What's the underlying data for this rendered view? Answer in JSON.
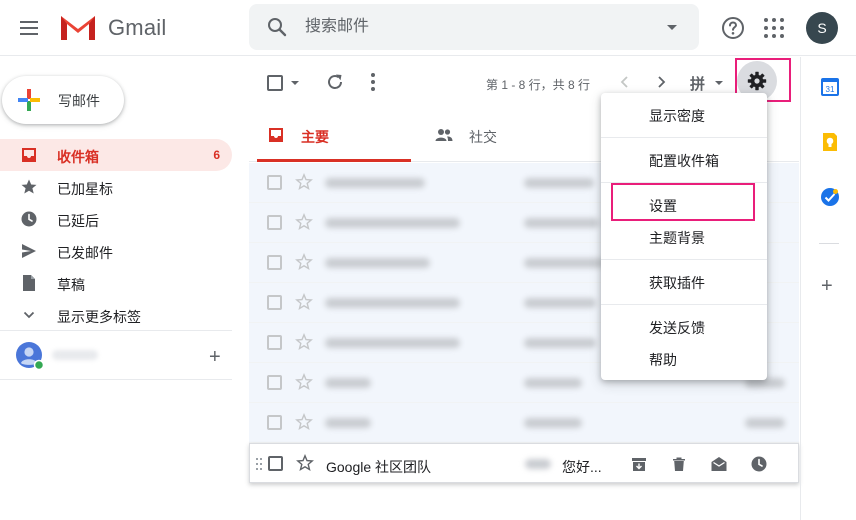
{
  "header": {
    "brand": "Gmail",
    "search_placeholder": "搜索邮件",
    "account_initial": "S",
    "icons": [
      "menu-icon",
      "gmail-logo",
      "search-icon",
      "search-options-icon",
      "help-icon",
      "apps-icon"
    ]
  },
  "compose": {
    "label": "写邮件"
  },
  "nav": {
    "items": [
      {
        "label": "收件箱",
        "count": "6",
        "icon": "inbox-icon",
        "active": true
      },
      {
        "label": "已加星标",
        "count": "",
        "icon": "star-icon",
        "active": false
      },
      {
        "label": "已延后",
        "count": "",
        "icon": "clock-icon",
        "active": false
      },
      {
        "label": "已发邮件",
        "count": "",
        "icon": "send-icon",
        "active": false
      },
      {
        "label": "草稿",
        "count": "",
        "icon": "draft-icon",
        "active": false
      },
      {
        "label": "显示更多标签",
        "count": "",
        "icon": "chevron-down-icon",
        "active": false
      }
    ]
  },
  "toolbar": {
    "page_info": "第 1 - 8 行，共 8 行",
    "ime_label": "拼"
  },
  "tabs": [
    {
      "label": "主要",
      "icon": "inbox-icon"
    },
    {
      "label": "社交",
      "icon": "people-icon"
    }
  ],
  "mails": {
    "hover_row": {
      "sender": "Google 社区团队",
      "snippet": "您好..."
    }
  },
  "settings_menu": {
    "items": [
      "显示密度",
      "配置收件箱",
      "设置",
      "主题背景",
      "获取插件",
      "发送反馈",
      "帮助"
    ]
  },
  "side_panel": {
    "icons": [
      "calendar-icon",
      "keep-icon",
      "tasks-icon",
      "add-icon"
    ],
    "calendar_day": "31",
    "add_label": "+"
  },
  "colors": {
    "accent_red": "#d93025",
    "highlight_pink": "#e91e7a",
    "active_nav_bg": "#fce8e6"
  }
}
